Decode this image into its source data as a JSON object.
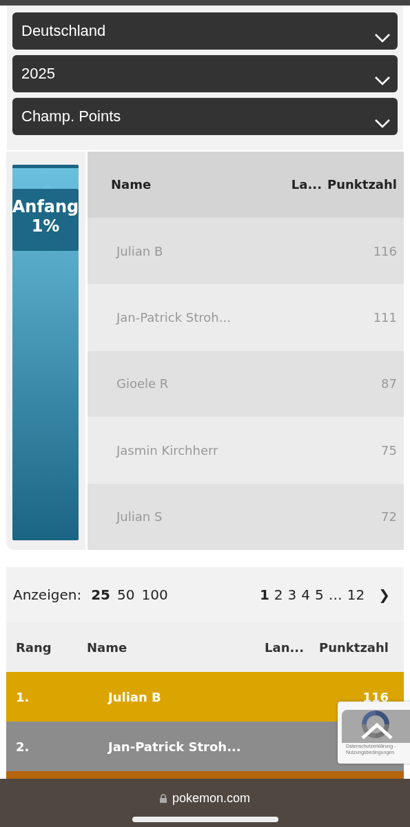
{
  "filters": [
    {
      "value": "Deutschland"
    },
    {
      "value": "2025"
    },
    {
      "value": "Champ. Points"
    }
  ],
  "meter": {
    "label": "Anfang",
    "percent": "1%"
  },
  "preview_table": {
    "columns": [
      "Name",
      "La...",
      "Punktzahl"
    ],
    "rows": [
      {
        "name": "Julian B",
        "points": "116"
      },
      {
        "name": "Jan-Patrick Stroh...",
        "points": "111"
      },
      {
        "name": "Gioele R",
        "points": "87"
      },
      {
        "name": "Jasmin Kirchherr",
        "points": "75"
      },
      {
        "name": "Julian S",
        "points": "72"
      }
    ]
  },
  "per_page": {
    "label": "Anzeigen:",
    "options": [
      {
        "label": "25",
        "selected": true
      },
      {
        "label": "50",
        "selected": false
      },
      {
        "label": "100",
        "selected": false
      }
    ]
  },
  "pagination": {
    "pages": [
      {
        "label": "1",
        "selected": true
      },
      {
        "label": "2",
        "selected": false
      },
      {
        "label": "3",
        "selected": false
      },
      {
        "label": "4",
        "selected": false
      },
      {
        "label": "5",
        "selected": false
      },
      {
        "label": "…",
        "selected": false
      },
      {
        "label": "12",
        "selected": false
      }
    ],
    "next": "❯"
  },
  "ranking_table": {
    "columns": [
      "Rang",
      "Name",
      "Lan...",
      "Punktzahl"
    ],
    "rows": [
      {
        "rank": "1.",
        "name": "Julian B",
        "points": "116",
        "color": "#dba500"
      },
      {
        "rank": "2.",
        "name": "Jan-Patrick Stroh...",
        "color": "#8c8c8c"
      },
      {
        "color": "#b4650e"
      }
    ]
  },
  "recaptcha": {
    "privacy": "Datenschutzerklärung -",
    "terms": "Nutzungsbedingungen"
  },
  "browser_bar": {
    "url": "pokemon.com"
  }
}
